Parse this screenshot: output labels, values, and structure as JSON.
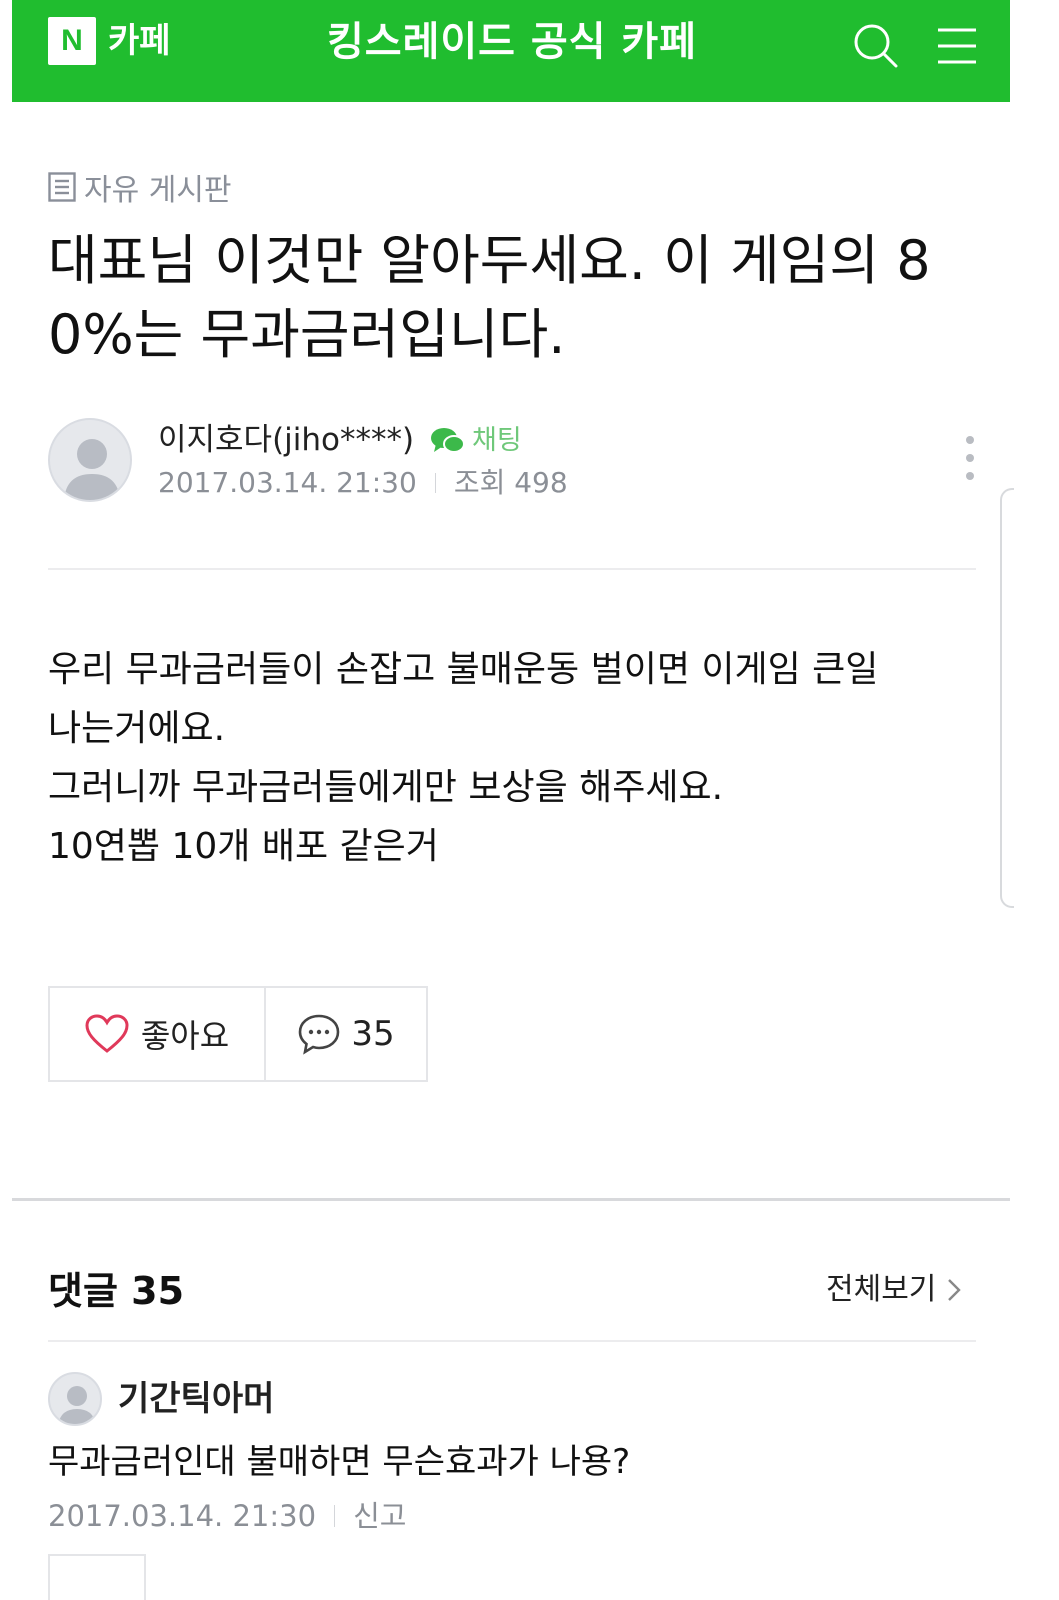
{
  "header": {
    "logo_letter": "N",
    "logo_label": "카페",
    "cafe_title": "킹스레이드 공식 카페",
    "brand_color": "#20bd2f",
    "icons": [
      "search-icon",
      "menu-icon"
    ]
  },
  "post": {
    "board_label": "자유 게시판",
    "title": "대표님 이것만 알아두세요. 이 게임의 80%는 무과금러입니다.",
    "author": "이지호다(jiho****)",
    "chat_label": "채팅",
    "date": "2017.03.14. 21:30",
    "views_label": "조회 498",
    "content_lines": [
      "우리 무과금러들이 손잡고 불매운동 벌이면 이게임 큰일",
      "나는거에요.",
      "그러니까 무과금러들에게만 보상을 해주세요.",
      "10연뽑 10개 배포 같은거"
    ],
    "like_label": "좋아요",
    "comment_count": "35"
  },
  "comments": {
    "heading": "댓글",
    "count": "35",
    "view_all_label": "전체보기",
    "items": [
      {
        "author": "기간틱아머",
        "text": "무과금러인대 불매하면 무슨효과가 나용?",
        "date": "2017.03.14. 21:30",
        "report_label": "신고"
      }
    ]
  }
}
